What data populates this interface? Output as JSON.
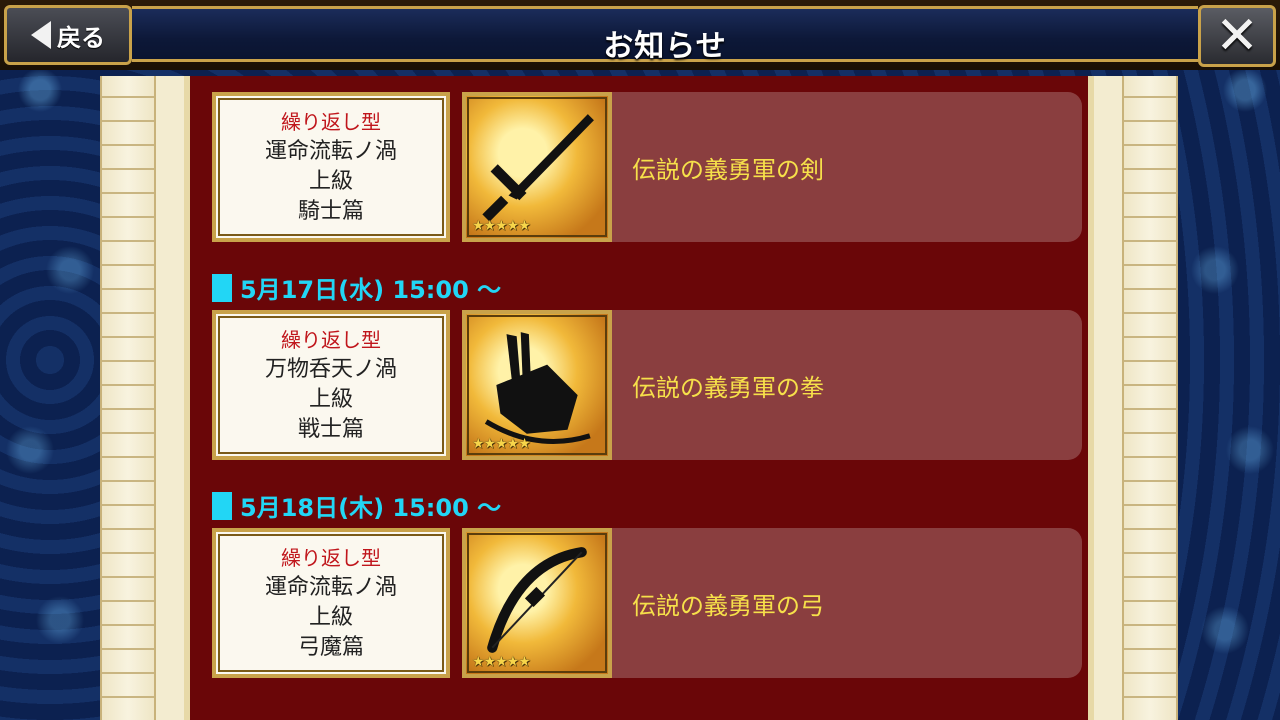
{
  "header": {
    "title": "お知らせ",
    "back_label": "戻る"
  },
  "items": [
    {
      "quest_type": "繰り返し型",
      "quest_name": "運命流転ノ渦",
      "difficulty": "上級",
      "chapter": "騎士篇",
      "reward": "伝説の義勇軍の剣",
      "reward_icon": "sword-icon",
      "stars": "★★★★★"
    },
    {
      "date": "5月17日(水) 15:00 〜",
      "quest_type": "繰り返し型",
      "quest_name": "万物呑天ノ渦",
      "difficulty": "上級",
      "chapter": "戦士篇",
      "reward": "伝説の義勇軍の拳",
      "reward_icon": "fist-icon",
      "stars": "★★★★★"
    },
    {
      "date": "5月18日(木) 15:00 〜",
      "quest_type": "繰り返し型",
      "quest_name": "運命流転ノ渦",
      "difficulty": "上級",
      "chapter": "弓魔篇",
      "reward": "伝説の義勇軍の弓",
      "reward_icon": "bow-icon",
      "stars": "★★★★★"
    }
  ],
  "colors": {
    "accent_gold": "#c9a24a",
    "panel_red": "#6a0608",
    "date_cyan": "#22d6f5",
    "reward_yellow": "#f6e04a",
    "quest_type_red": "#c0161c"
  }
}
